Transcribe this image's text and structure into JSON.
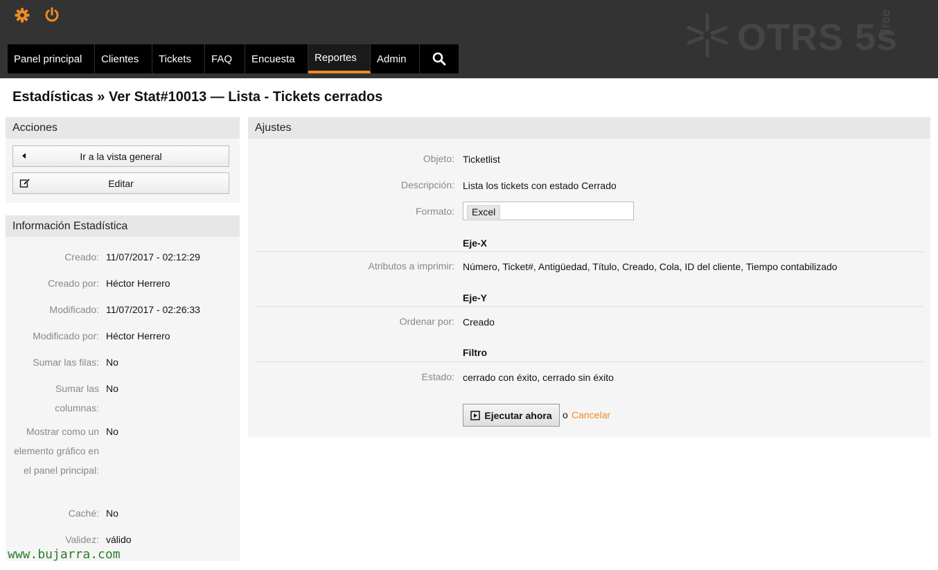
{
  "header": {
    "settings_icon": "gear-icon",
    "logout_icon": "power-icon",
    "logo_text": "OTRS 5s",
    "logo_free": "Free",
    "accent_color": "#f08a24"
  },
  "nav": {
    "items": [
      {
        "label": "Panel principal"
      },
      {
        "label": "Clientes"
      },
      {
        "label": "Tickets"
      },
      {
        "label": "FAQ"
      },
      {
        "label": "Encuesta"
      },
      {
        "label": "Reportes",
        "active": true
      },
      {
        "label": "Admin"
      }
    ],
    "search_icon": "search-icon"
  },
  "page": {
    "title": "Estadísticas » Ver Stat#10013 — Lista - Tickets cerrados"
  },
  "actions": {
    "heading": "Acciones",
    "overview_label": "Ir a la vista general",
    "edit_label": "Editar"
  },
  "stat_info": {
    "heading": "Información Estadística",
    "rows": [
      {
        "label": "Creado:",
        "value": "11/07/2017 - 02:12:29"
      },
      {
        "label": "Creado por:",
        "value": "Héctor Herrero"
      },
      {
        "label": "Modificado:",
        "value": "11/07/2017 - 02:26:33"
      },
      {
        "label": "Modificado por:",
        "value": "Héctor Herrero"
      },
      {
        "label": "Sumar las filas:",
        "value": "No"
      },
      {
        "label": "Sumar las columnas:",
        "value": "No"
      },
      {
        "label": "Mostrar como un elemento gráfico en el panel principal:",
        "value": "No"
      },
      {
        "label": "Caché:",
        "value": "No"
      },
      {
        "label": "Validez:",
        "value": "válido"
      }
    ]
  },
  "settings": {
    "heading": "Ajustes",
    "object_label": "Objeto:",
    "object_value": "Ticketlist",
    "description_label": "Descripción:",
    "description_value": "Lista los tickets con estado Cerrado",
    "format_label": "Formato:",
    "format_value": "Excel",
    "x_axis_heading": "Eje-X",
    "attributes_label": "Atributos a imprimir:",
    "attributes_value": "Número, Ticket#, Antigüedad, Título, Creado, Cola, ID del cliente, Tiempo contabilizado",
    "y_axis_heading": "Eje-Y",
    "order_label": "Ordenar por:",
    "order_value": "Creado",
    "filter_heading": "Filtro",
    "state_label": "Estado:",
    "state_value": "cerrado con éxito, cerrado sin éxito",
    "run_label": "Ejecutar ahora",
    "or_label": "o",
    "cancel_label": "Cancelar"
  },
  "watermark": "www.bujarra.com"
}
